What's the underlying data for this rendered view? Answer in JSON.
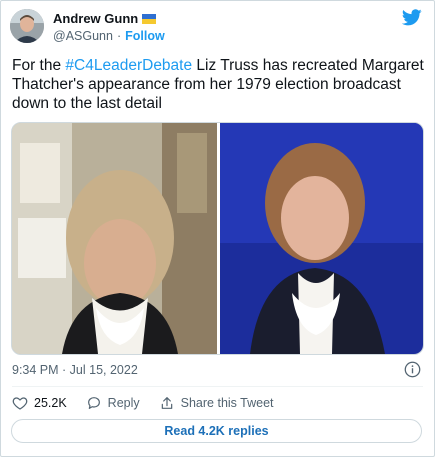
{
  "author": {
    "display_name": "Andrew Gunn",
    "handle": "@ASGunn",
    "separator": "·",
    "follow_label": "Follow"
  },
  "tweet": {
    "text_before": "For the ",
    "hashtag": "#C4LeaderDebate",
    "text_after": " Liz Truss has recreated Margaret Thatcher's appearance from her 1979 election broadcast down to the last detail"
  },
  "meta": {
    "timestamp": "9:34 PM · Jul 15, 2022"
  },
  "actions": {
    "like_count": "25.2K",
    "reply_label": "Reply",
    "share_label": "Share this Tweet"
  },
  "read_replies_label": "Read 4.2K replies",
  "icons": {
    "brand": "twitter-bird-icon",
    "info": "info-icon",
    "like": "heart-icon",
    "reply": "speech-bubble-icon",
    "share": "share-arrow-icon"
  },
  "colors": {
    "accent": "#1d9bf0",
    "muted": "#536471",
    "text": "#0f1419",
    "border": "#cfd9de"
  }
}
